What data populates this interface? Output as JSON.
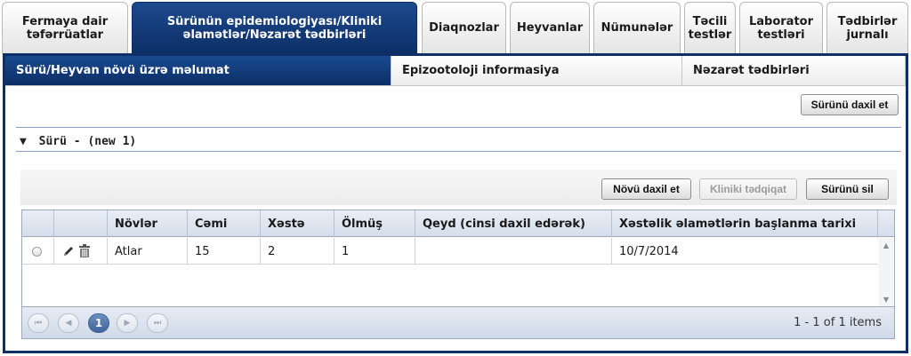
{
  "top_tabs": [
    {
      "label": "Fermaya dair təfərrüatlar",
      "active": false
    },
    {
      "label": "Sürünün epidemiologiyası/Kliniki əlamətlər/Nəzarət tədbirləri",
      "active": true
    },
    {
      "label": "Diaqnozlar",
      "active": false
    },
    {
      "label": "Heyvanlar",
      "active": false
    },
    {
      "label": "Nümunələr",
      "active": false
    },
    {
      "label": "Təcili testlər",
      "active": false
    },
    {
      "label": "Laborator testləri",
      "active": false
    },
    {
      "label": "Tədbirlər jurnalı",
      "active": false
    }
  ],
  "sub_tabs": [
    {
      "label": "Sürü/Heyvan növü üzrə məlumat",
      "active": true
    },
    {
      "label": "Epizootoloji informasiya",
      "active": false
    },
    {
      "label": "Nəzarət tədbirləri",
      "active": false
    }
  ],
  "herd_add_button": "Sürünü daxil et",
  "section": {
    "toggle": "▼",
    "title": "Sürü - (new 1)"
  },
  "toolbar": {
    "add_species": "Növü daxil et",
    "clinical_exam": "Kliniki tədqiqat",
    "delete_herd": "Sürünü sil"
  },
  "grid": {
    "columns": [
      "",
      "",
      "Növlər",
      "Cəmi",
      "Xəstə",
      "Ölmüş",
      "Qeyd (cinsi daxil edərək)",
      "Xəstəlik əlamətlərin başlanma tarixi"
    ],
    "rows": [
      {
        "species": "Atlar",
        "total": "15",
        "sick": "2",
        "dead": "1",
        "note": "",
        "onset_date": "10/7/2014"
      }
    ]
  },
  "pager": {
    "first": "⏮",
    "prev": "◀",
    "current_page": "1",
    "next": "▶",
    "last": "⏭",
    "info": "1 - 1 of 1 items"
  },
  "icons": {
    "edit": "pencil-icon",
    "delete": "trash-icon"
  },
  "colors": {
    "active_tab": "#0d2f66",
    "panel_border": "#0e2f68"
  }
}
